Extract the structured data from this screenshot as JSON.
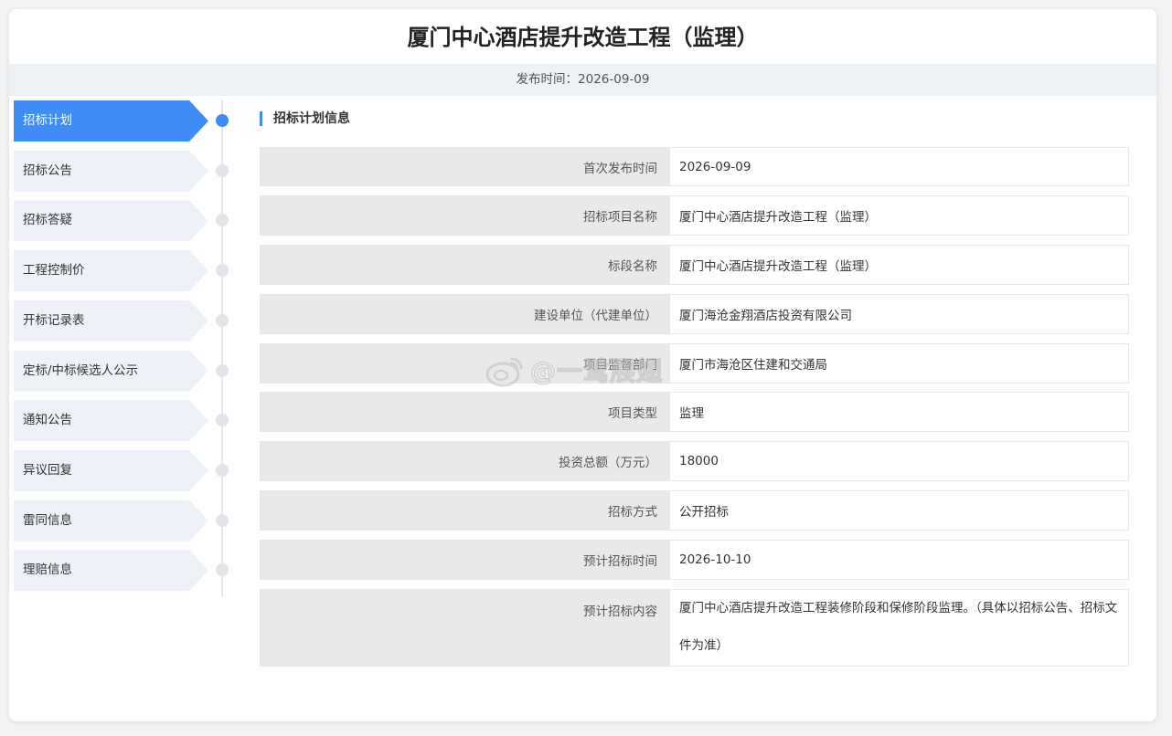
{
  "page": {
    "title": "厦门中心酒店提升改造工程（监理）",
    "publish_label": "发布时间：",
    "publish_date": "2026-09-09"
  },
  "nav": {
    "items": [
      {
        "label": "招标计划",
        "active": true
      },
      {
        "label": "招标公告",
        "active": false
      },
      {
        "label": "招标答疑",
        "active": false
      },
      {
        "label": "工程控制价",
        "active": false
      },
      {
        "label": "开标记录表",
        "active": false
      },
      {
        "label": "定标/中标候选人公示",
        "active": false
      },
      {
        "label": "通知公告",
        "active": false
      },
      {
        "label": "异议回复",
        "active": false
      },
      {
        "label": "雷同信息",
        "active": false
      },
      {
        "label": "理赔信息",
        "active": false
      }
    ],
    "active_color": "#3e8cf6"
  },
  "section": {
    "title": "招标计划信息"
  },
  "info_rows": [
    {
      "label": "首次发布时间",
      "value": "2026-09-09"
    },
    {
      "label": "招标项目名称",
      "value": "厦门中心酒店提升改造工程（监理）"
    },
    {
      "label": "标段名称",
      "value": "厦门中心酒店提升改造工程（监理）"
    },
    {
      "label": "建设单位（代建单位）",
      "value": "厦门海沧金翔酒店投资有限公司"
    },
    {
      "label": "项目监督部门",
      "value": "厦门市海沧区住建和交通局"
    },
    {
      "label": "项目类型",
      "value": "监理"
    },
    {
      "label": "投资总额（万元）",
      "value": "18000"
    },
    {
      "label": "招标方式",
      "value": "公开招标"
    },
    {
      "label": "预计招标时间",
      "value": "2026-10-10"
    },
    {
      "label": "预计招标内容",
      "value": "厦门中心酒店提升改造工程装修阶段和保修阶段监理。（具体以招标公告、招标文件为准）"
    }
  ],
  "watermark": {
    "icon": "weibo-icon",
    "text": "@一鹭展翅"
  }
}
